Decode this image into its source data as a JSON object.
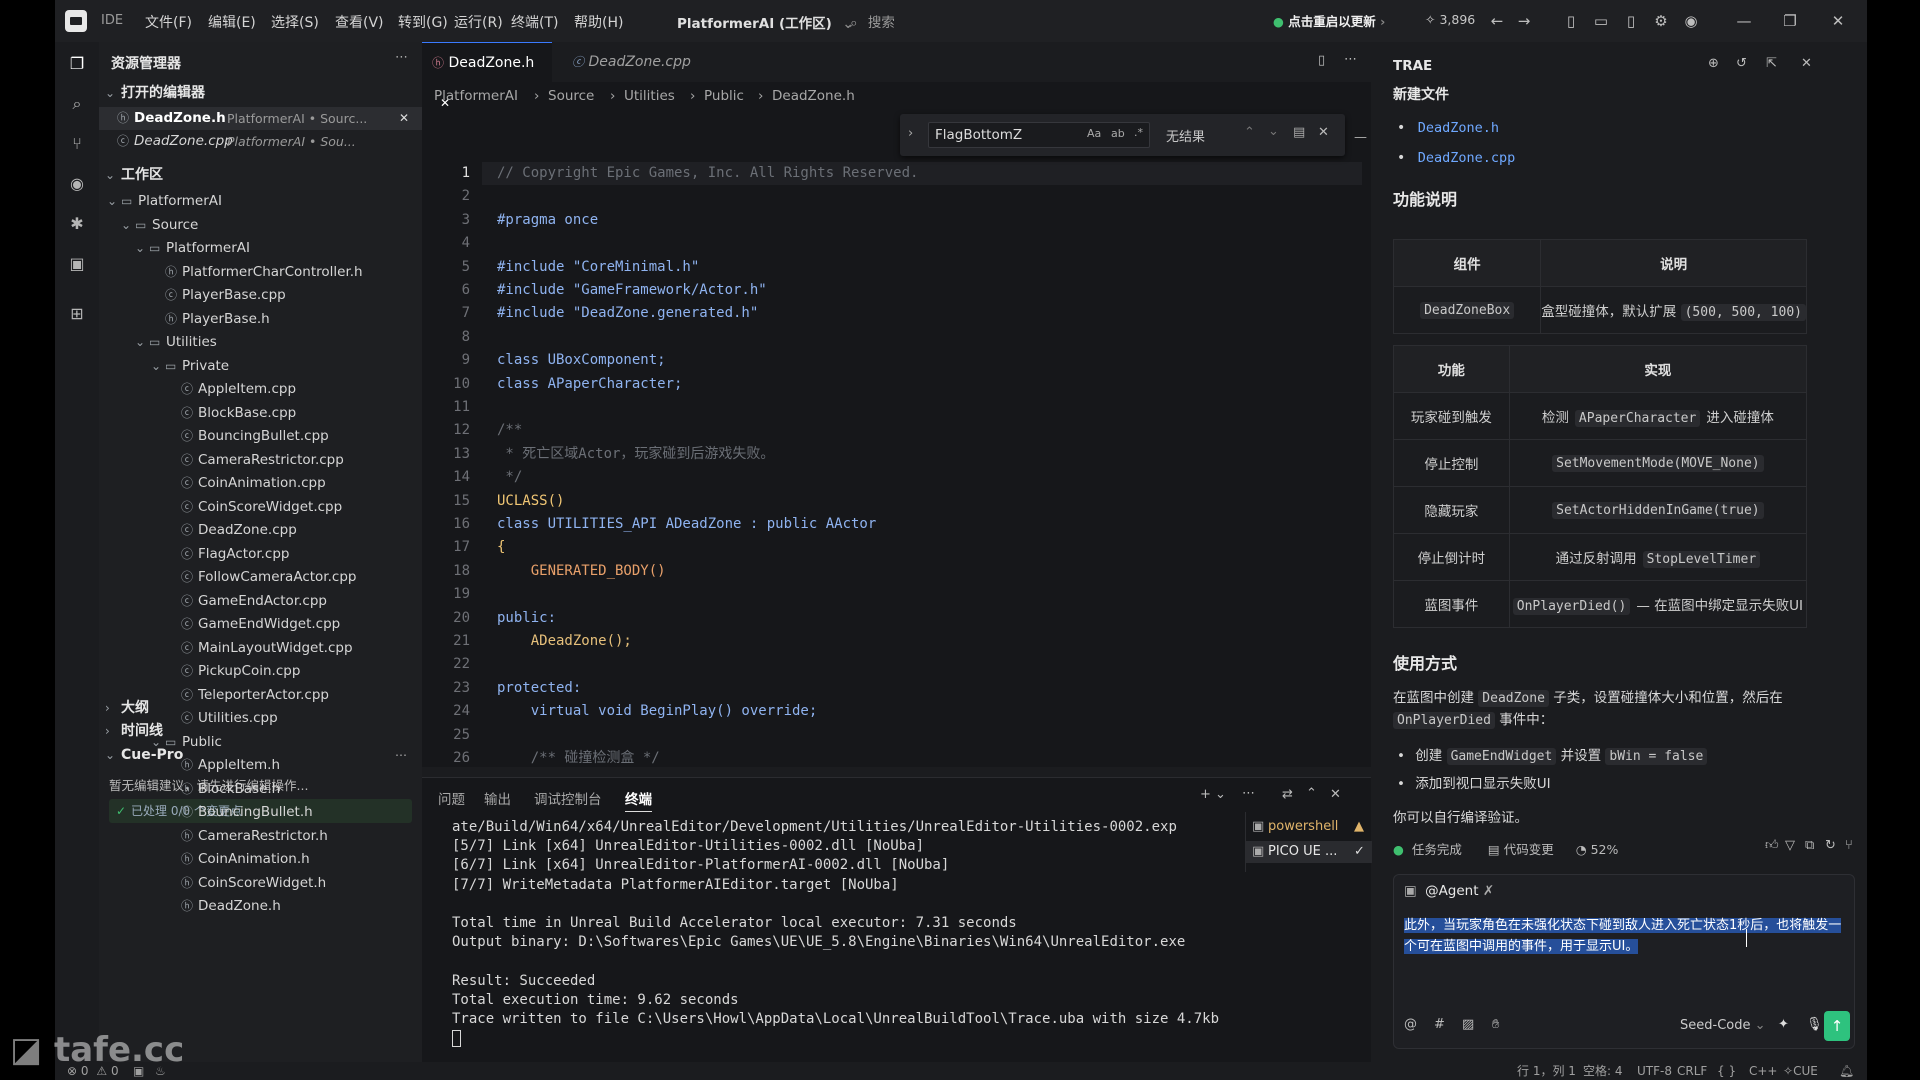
{
  "titlebar": {
    "app_label": "IDE",
    "menu": [
      "文件(F)",
      "编辑(E)",
      "选择(S)",
      "查看(V)",
      "转到(G)",
      "运行(R)",
      "终端(T)",
      "帮助(H)"
    ],
    "workspace": "PlatformerAI (工作区)",
    "search_placeholder": "搜索",
    "update_label": "点击重启以更新",
    "counter": "3,896"
  },
  "explorer": {
    "title": "资源管理器",
    "open_editors_label": "打开的编辑器",
    "open_editors": [
      {
        "name": "DeadZone.h",
        "path": "PlatformerAI • Sourc..."
      },
      {
        "name": "DeadZone.cpp",
        "path": "PlatformerAI • Sou..."
      }
    ],
    "workspace_label": "工作区",
    "tree": [
      {
        "label": "PlatformerAI",
        "kind": "folder"
      },
      {
        "label": "Source",
        "kind": "folder"
      },
      {
        "label": "PlatformerAI",
        "kind": "folder"
      },
      {
        "label": "PlatformerCharController.h",
        "kind": "h"
      },
      {
        "label": "PlayerBase.cpp",
        "kind": "cpp"
      },
      {
        "label": "PlayerBase.h",
        "kind": "h"
      },
      {
        "label": "Utilities",
        "kind": "folder"
      },
      {
        "label": "Private",
        "kind": "folder"
      },
      {
        "label": "AppleItem.cpp",
        "kind": "cpp"
      },
      {
        "label": "BlockBase.cpp",
        "kind": "cpp"
      },
      {
        "label": "BouncingBullet.cpp",
        "kind": "cpp"
      },
      {
        "label": "CameraRestrictor.cpp",
        "kind": "cpp"
      },
      {
        "label": "CoinAnimation.cpp",
        "kind": "cpp"
      },
      {
        "label": "CoinScoreWidget.cpp",
        "kind": "cpp"
      },
      {
        "label": "DeadZone.cpp",
        "kind": "cpp"
      },
      {
        "label": "FlagActor.cpp",
        "kind": "cpp"
      },
      {
        "label": "FollowCameraActor.cpp",
        "kind": "cpp"
      },
      {
        "label": "GameEndActor.cpp",
        "kind": "cpp"
      },
      {
        "label": "GameEndWidget.cpp",
        "kind": "cpp"
      },
      {
        "label": "MainLayoutWidget.cpp",
        "kind": "cpp"
      },
      {
        "label": "PickupCoin.cpp",
        "kind": "cpp"
      },
      {
        "label": "TeleporterActor.cpp",
        "kind": "cpp"
      },
      {
        "label": "Utilities.cpp",
        "kind": "cpp"
      },
      {
        "label": "Public",
        "kind": "folder"
      },
      {
        "label": "AppleItem.h",
        "kind": "h"
      },
      {
        "label": "BlockBase.h",
        "kind": "h"
      },
      {
        "label": "BouncingBullet.h",
        "kind": "h"
      },
      {
        "label": "CameraRestrictor.h",
        "kind": "h"
      },
      {
        "label": "CoinAnimation.h",
        "kind": "h"
      },
      {
        "label": "CoinScoreWidget.h",
        "kind": "h"
      },
      {
        "label": "DeadZone.h",
        "kind": "h"
      }
    ],
    "outline_label": "大纲",
    "timeline_label": "时间线",
    "cue_label": "Cue-Pro",
    "cue_hint": "暂无编辑建议，请先进行编辑操作...",
    "cue_status": "已处理 0/0 个变更点"
  },
  "editor": {
    "tabs": [
      {
        "label": "DeadZone.h",
        "active": true
      },
      {
        "label": "DeadZone.cpp",
        "active": false
      }
    ],
    "breadcrumb": [
      "PlatformerAI",
      "Source",
      "Utilities",
      "Public",
      "DeadZone.h"
    ],
    "find": {
      "query": "FlagBottomZ",
      "result": "无结果"
    },
    "lines": [
      {
        "n": "1",
        "text": "// Copyright Epic Games, Inc. All Rights Reserved.",
        "cls": "c-comment"
      },
      {
        "n": "2",
        "text": "",
        "cls": "c-plain"
      },
      {
        "n": "3",
        "text": "#pragma once",
        "cls": "c-kw"
      },
      {
        "n": "4",
        "text": "",
        "cls": "c-plain"
      },
      {
        "n": "5",
        "text": "#include \"CoreMinimal.h\"",
        "cls": "c-kw"
      },
      {
        "n": "6",
        "text": "#include \"GameFramework/Actor.h\"",
        "cls": "c-kw"
      },
      {
        "n": "7",
        "text": "#include \"DeadZone.generated.h\"",
        "cls": "c-kw"
      },
      {
        "n": "8",
        "text": "",
        "cls": "c-plain"
      },
      {
        "n": "9",
        "text": "class UBoxComponent;",
        "cls": "c-kw"
      },
      {
        "n": "10",
        "text": "class APaperCharacter;",
        "cls": "c-kw"
      },
      {
        "n": "11",
        "text": "",
        "cls": "c-plain"
      },
      {
        "n": "12",
        "text": "/**",
        "cls": "c-comment"
      },
      {
        "n": "13",
        "text": " * 死亡区域Actor，玩家碰到后游戏失败。",
        "cls": "c-comment"
      },
      {
        "n": "14",
        "text": " */",
        "cls": "c-comment"
      },
      {
        "n": "15",
        "text": "UCLASS()",
        "cls": "c-macro"
      },
      {
        "n": "16",
        "text": "class UTILITIES_API ADeadZone : public AActor",
        "cls": "c-kw"
      },
      {
        "n": "17",
        "text": "{",
        "cls": "c-macro"
      },
      {
        "n": "18",
        "text": "    GENERATED_BODY()",
        "cls": "c-orange"
      },
      {
        "n": "19",
        "text": "",
        "cls": "c-plain"
      },
      {
        "n": "20",
        "text": "public:",
        "cls": "c-kw"
      },
      {
        "n": "21",
        "text": "    ADeadZone();",
        "cls": "c-fn"
      },
      {
        "n": "22",
        "text": "",
        "cls": "c-plain"
      },
      {
        "n": "23",
        "text": "protected:",
        "cls": "c-kw"
      },
      {
        "n": "24",
        "text": "    virtual void BeginPlay() override;",
        "cls": "c-kw"
      },
      {
        "n": "25",
        "text": "",
        "cls": "c-plain"
      },
      {
        "n": "26",
        "text": "    /** 碰撞检测盒 */",
        "cls": "c-comment"
      }
    ]
  },
  "terminal": {
    "tabs": [
      "问题",
      "输出",
      "调试控制台",
      "终端"
    ],
    "active_tab": "终端",
    "lines": [
      "ate/Build/Win64/x64/UnrealEditor/Development/Utilities/UnrealEditor-Utilities-0002.exp",
      "[5/7] Link [x64] UnrealEditor-Utilities-0002.dll [NoUba]",
      "[6/7] Link [x64] UnrealEditor-PlatformerAI-0002.dll [NoUba]",
      "[7/7] WriteMetadata PlatformerAIEditor.target [NoUba]",
      "",
      "Total time in Unreal Build Accelerator local executor: 7.31 seconds",
      "Output binary: D:\\Softwares\\Epic Games\\UE\\UE_5.8\\Engine\\Binaries\\Win64\\UnrealEditor.exe",
      "",
      "Result: Succeeded",
      "Total execution time: 9.62 seconds",
      "Trace written to file C:\\Users\\Howl\\AppData\\Local\\UnrealBuildTool\\Trace.uba with size 4.7kb"
    ],
    "sessions": [
      {
        "label": "powershell",
        "status": "warning"
      },
      {
        "label": "PICO UE ...",
        "status": "ok"
      }
    ]
  },
  "chat": {
    "title": "TRAE",
    "new_files_heading": "新建文件",
    "new_files": [
      "DeadZone.h",
      "DeadZone.cpp"
    ],
    "func_heading": "功能说明",
    "table1": {
      "headers": [
        "组件",
        "说明"
      ],
      "rows": [
        [
          "DeadZoneBox",
          "盒型碰撞体，默认扩展",
          "(500, 500, 100)"
        ]
      ]
    },
    "table2": {
      "headers": [
        "功能",
        "实现"
      ],
      "rows": [
        [
          "玩家碰到触发",
          "检测",
          "APaperCharacter",
          "进入碰撞体"
        ],
        [
          "停止控制",
          "",
          "SetMovementMode(MOVE_None)",
          ""
        ],
        [
          "隐藏玩家",
          "",
          "SetActorHiddenInGame(true)",
          ""
        ],
        [
          "停止倒计时",
          "通过反射调用",
          "StopLevelTimer",
          ""
        ],
        [
          "蓝图事件",
          "",
          "OnPlayerDied()",
          "— 在蓝图中绑定显示失败UI"
        ]
      ]
    },
    "usage_heading": "使用方式",
    "usage_line1_a": "在蓝图中创建",
    "usage_line1_code": "DeadZone",
    "usage_line1_b": "子类，设置碰撞体大小和位置，然后在",
    "usage_line2_code": "OnPlayerDied",
    "usage_line2_b": "事件中：",
    "bullets": [
      {
        "a": "创建",
        "code": "GameEndWidget",
        "b": "并设置",
        "code2": "bWin = false"
      },
      {
        "a": "添加到视口显示失败UI",
        "code": "",
        "b": "",
        "code2": ""
      }
    ],
    "closing": "你可以自行编译验证。",
    "task_done": "任务完成",
    "code_change": "代码变更",
    "progress": "52%",
    "agent_label": "@Agent",
    "input_text_1": "此外，当玩家角色在未强化状态下碰到敌人进入死亡状态1秒后，也将触发一",
    "input_text_2": "个可在蓝图中调用的事件，用于显示UI。",
    "model": "Seed-Code"
  },
  "statusbar": {
    "errors": "0",
    "warnings": "0",
    "position": "行 1，列 1",
    "spaces": "空格: 4",
    "encoding": "UTF-8",
    "eol": "CRLF",
    "lang": "C++",
    "cue": "CUE"
  },
  "watermark": "tafe.cc"
}
